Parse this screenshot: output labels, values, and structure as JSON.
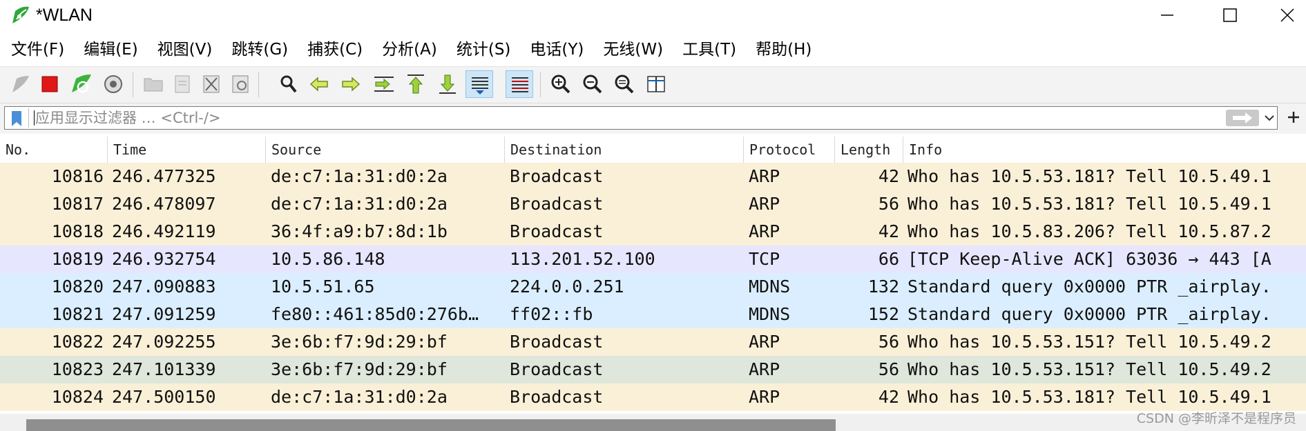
{
  "window": {
    "title": "*WLAN"
  },
  "menu": [
    "文件(F)",
    "编辑(E)",
    "视图(V)",
    "跳转(G)",
    "捕获(C)",
    "分析(A)",
    "统计(S)",
    "电话(Y)",
    "无线(W)",
    "工具(T)",
    "帮助(H)"
  ],
  "toolbar_icons": [
    "shark-fin-start-icon",
    "stop-capture-icon",
    "restart-capture-icon",
    "capture-options-icon",
    "open-file-icon",
    "save-file-icon",
    "close-file-icon",
    "reload-file-icon",
    "find-packet-icon",
    "go-back-icon",
    "go-forward-icon",
    "go-to-packet-icon",
    "first-packet-icon",
    "last-packet-icon",
    "autoscroll-icon",
    "colorize-icon",
    "zoom-in-icon",
    "zoom-out-icon",
    "normal-size-icon",
    "resize-columns-icon"
  ],
  "filter": {
    "placeholder": "应用显示过滤器 … <Ctrl-/>"
  },
  "columns": [
    "No.",
    "Time",
    "Source",
    "Destination",
    "Protocol",
    "Length",
    "Info"
  ],
  "colors": {
    "arp": "#faf0d7",
    "tcp": "#e7e6ff",
    "mdns": "#daeeff",
    "arp_alt": "#dfe6db"
  },
  "packets": [
    {
      "no": "10816",
      "time": "246.477325",
      "src": "de:c7:1a:31:d0:2a",
      "dst": "Broadcast",
      "proto": "ARP",
      "len": "42",
      "info": "Who has 10.5.53.181? Tell 10.5.49.1",
      "color": "#faf0d7"
    },
    {
      "no": "10817",
      "time": "246.478097",
      "src": "de:c7:1a:31:d0:2a",
      "dst": "Broadcast",
      "proto": "ARP",
      "len": "56",
      "info": "Who has 10.5.53.181? Tell 10.5.49.1",
      "color": "#faf0d7"
    },
    {
      "no": "10818",
      "time": "246.492119",
      "src": "36:4f:a9:b7:8d:1b",
      "dst": "Broadcast",
      "proto": "ARP",
      "len": "42",
      "info": "Who has 10.5.83.206? Tell 10.5.87.2",
      "color": "#faf0d7"
    },
    {
      "no": "10819",
      "time": "246.932754",
      "src": "10.5.86.148",
      "dst": "113.201.52.100",
      "proto": "TCP",
      "len": "66",
      "info": "[TCP Keep-Alive ACK] 63036 → 443 [A",
      "color": "#e7e6ff"
    },
    {
      "no": "10820",
      "time": "247.090883",
      "src": "10.5.51.65",
      "dst": "224.0.0.251",
      "proto": "MDNS",
      "len": "132",
      "info": "Standard query 0x0000 PTR _airplay.",
      "color": "#daeeff"
    },
    {
      "no": "10821",
      "time": "247.091259",
      "src": "fe80::461:85d0:276b…",
      "dst": "ff02::fb",
      "proto": "MDNS",
      "len": "152",
      "info": "Standard query 0x0000 PTR _airplay.",
      "color": "#daeeff"
    },
    {
      "no": "10822",
      "time": "247.092255",
      "src": "3e:6b:f7:9d:29:bf",
      "dst": "Broadcast",
      "proto": "ARP",
      "len": "56",
      "info": "Who has 10.5.53.151? Tell 10.5.49.2",
      "color": "#faf0d7"
    },
    {
      "no": "10823",
      "time": "247.101339",
      "src": "3e:6b:f7:9d:29:bf",
      "dst": "Broadcast",
      "proto": "ARP",
      "len": "56",
      "info": "Who has 10.5.53.151? Tell 10.5.49.2",
      "color": "#dfe6db"
    },
    {
      "no": "10824",
      "time": "247.500150",
      "src": "de:c7:1a:31:d0:2a",
      "dst": "Broadcast",
      "proto": "ARP",
      "len": "42",
      "info": "Who has 10.5.53.181? Tell 10.5.49.1",
      "color": "#faf0d7"
    }
  ],
  "watermark": "CSDN @李昕泽不是程序员"
}
